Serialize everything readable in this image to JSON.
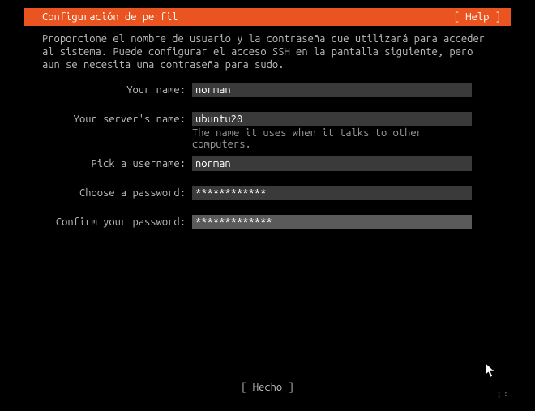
{
  "header": {
    "title": "Configuración de perfil",
    "help": "[ Help ]"
  },
  "intro": "Proporcione el nombre de usuario y la contraseña que utilizará para acceder al sistema. Puede configurar el acceso SSH en la pantalla siguiente, pero aun se necesita una contraseña para sudo.",
  "fields": {
    "name": {
      "label": "Your name:",
      "value": "norman"
    },
    "server": {
      "label": "Your server's name:",
      "value": "ubuntu20",
      "hint": "The name it uses when it talks to other computers."
    },
    "username": {
      "label": "Pick a username:",
      "value": "norman"
    },
    "password": {
      "label": "Choose a password:",
      "value": "************"
    },
    "confirm": {
      "label": "Confirm your password:",
      "value": "*************"
    }
  },
  "footer": {
    "done": "[ Hecho     ]"
  }
}
